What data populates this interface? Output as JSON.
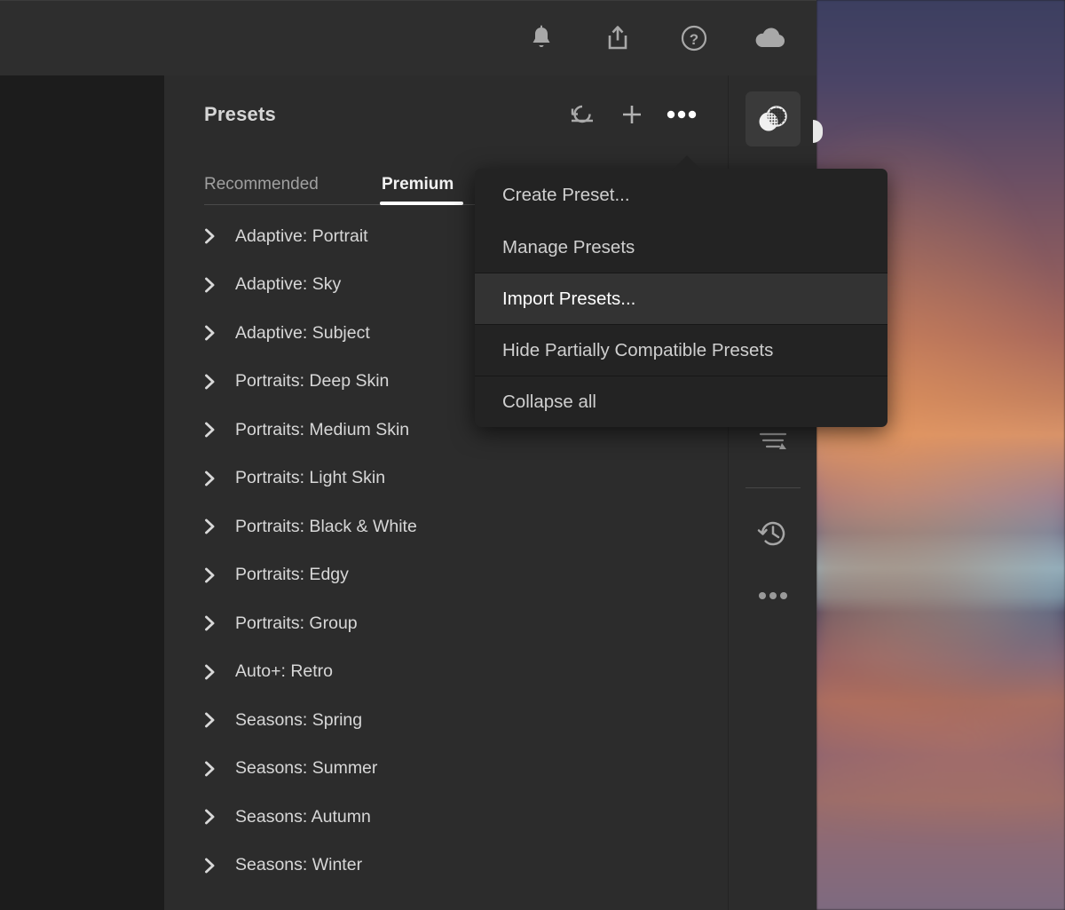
{
  "toolbar": {
    "icons": [
      {
        "name": "notifications-bell-icon",
        "label": "Notifications"
      },
      {
        "name": "share-export-icon",
        "label": "Share"
      },
      {
        "name": "help-circle-icon",
        "label": "Help"
      },
      {
        "name": "cloud-sync-icon",
        "label": "Cloud"
      }
    ]
  },
  "panel": {
    "title": "Presets",
    "actions": [
      {
        "name": "reset-undo-icon",
        "label": "Reset"
      },
      {
        "name": "add-preset-icon",
        "label": "Create Preset"
      },
      {
        "name": "more-options-icon",
        "label": "More options"
      }
    ],
    "tabs": [
      {
        "label": "Recommended",
        "active": false
      },
      {
        "label": "Premium",
        "active": true
      }
    ],
    "presets": [
      {
        "label": "Adaptive: Portrait"
      },
      {
        "label": "Adaptive: Sky"
      },
      {
        "label": "Adaptive: Subject"
      },
      {
        "label": "Portraits: Deep Skin"
      },
      {
        "label": "Portraits: Medium Skin"
      },
      {
        "label": "Portraits: Light Skin"
      },
      {
        "label": "Portraits: Black & White"
      },
      {
        "label": "Portraits: Edgy"
      },
      {
        "label": "Portraits: Group"
      },
      {
        "label": "Auto+: Retro"
      },
      {
        "label": "Seasons: Spring"
      },
      {
        "label": "Seasons: Summer"
      },
      {
        "label": "Seasons: Autumn"
      },
      {
        "label": "Seasons: Winter"
      }
    ]
  },
  "rail": {
    "items": [
      {
        "name": "presets-tool-icon",
        "label": "Presets",
        "active": true
      },
      {
        "name": "versions-tool-icon",
        "label": "Versions",
        "active": false
      },
      {
        "name": "history-clock-icon",
        "label": "History",
        "active": false
      },
      {
        "name": "rail-more-icon",
        "label": "More",
        "active": false
      }
    ]
  },
  "menu": {
    "items": [
      {
        "label": "Create Preset...",
        "highlighted": false
      },
      {
        "label": "Manage Presets",
        "highlighted": false
      },
      {
        "separator": true
      },
      {
        "label": "Import Presets...",
        "highlighted": true
      },
      {
        "separator": true
      },
      {
        "label": "Hide Partially Compatible Presets",
        "highlighted": false
      },
      {
        "separator": true
      },
      {
        "label": "Collapse all",
        "highlighted": false
      }
    ]
  },
  "colors": {
    "panel_bg": "#2c2c2c",
    "toolbar_bg": "#2e2e2e",
    "canvas_bg": "#1c1c1c",
    "menu_bg": "#232323",
    "menu_highlight": "#333333",
    "accent_text": "#ffffff",
    "muted_text": "#a0a0a0"
  }
}
